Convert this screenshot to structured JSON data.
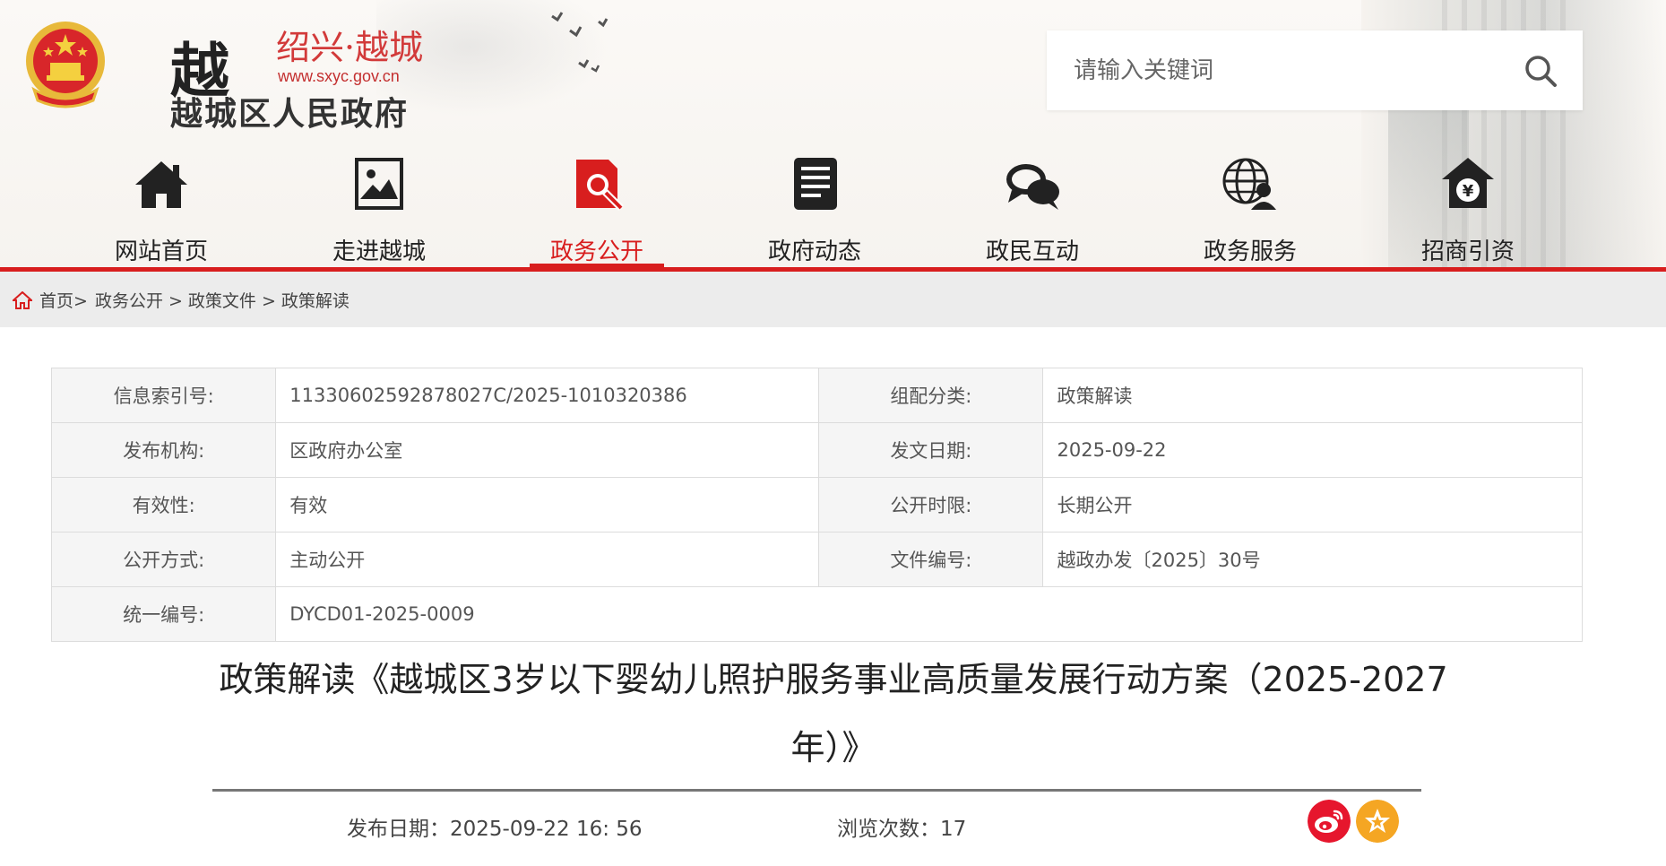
{
  "header": {
    "logo_char": "越",
    "logo_title": "绍兴·越城",
    "logo_url": "www.sxyc.gov.cn",
    "logo_subtitle": "越城区人民政府",
    "search_placeholder": "请输入关键词"
  },
  "nav": [
    {
      "label": "网站首页",
      "icon": "home-icon"
    },
    {
      "label": "走进越城",
      "icon": "picture-icon"
    },
    {
      "label": "政务公开",
      "icon": "document-search-icon",
      "active": true
    },
    {
      "label": "政府动态",
      "icon": "news-icon"
    },
    {
      "label": "政民互动",
      "icon": "chat-icon"
    },
    {
      "label": "政务服务",
      "icon": "globe-user-icon"
    },
    {
      "label": "招商引资",
      "icon": "yuan-house-icon"
    }
  ],
  "breadcrumb": [
    "首页",
    "政务公开",
    "政策文件",
    "政策解读"
  ],
  "info": {
    "index_label": "信息索引号:",
    "index_value": "11330602592878027C/2025-1010320386",
    "category_label": "组配分类:",
    "category_value": "政策解读",
    "org_label": "发布机构:",
    "org_value": "区政府办公室",
    "date_label": "发文日期:",
    "date_value": "2025-09-22",
    "validity_label": "有效性:",
    "validity_value": "有效",
    "limit_label": "公开时限:",
    "limit_value": "长期公开",
    "mode_label": "公开方式:",
    "mode_value": "主动公开",
    "docno_label": "文件编号:",
    "docno_value": "越政办发〔2025〕30号",
    "uid_label": "统一编号:",
    "uid_value": "DYCD01-2025-0009"
  },
  "article": {
    "title": "政策解读《越城区3岁以下婴幼儿照护服务事业高质量发展行动方案（2025-2027年）》",
    "publish_label": "发布日期：",
    "publish_value": "2025-09-22 16: 56",
    "views_label": "浏览次数：",
    "views_value": "17"
  },
  "colors": {
    "accent": "#d81e1e",
    "weibo": "#e6162d",
    "share_yellow": "#f5a623"
  }
}
